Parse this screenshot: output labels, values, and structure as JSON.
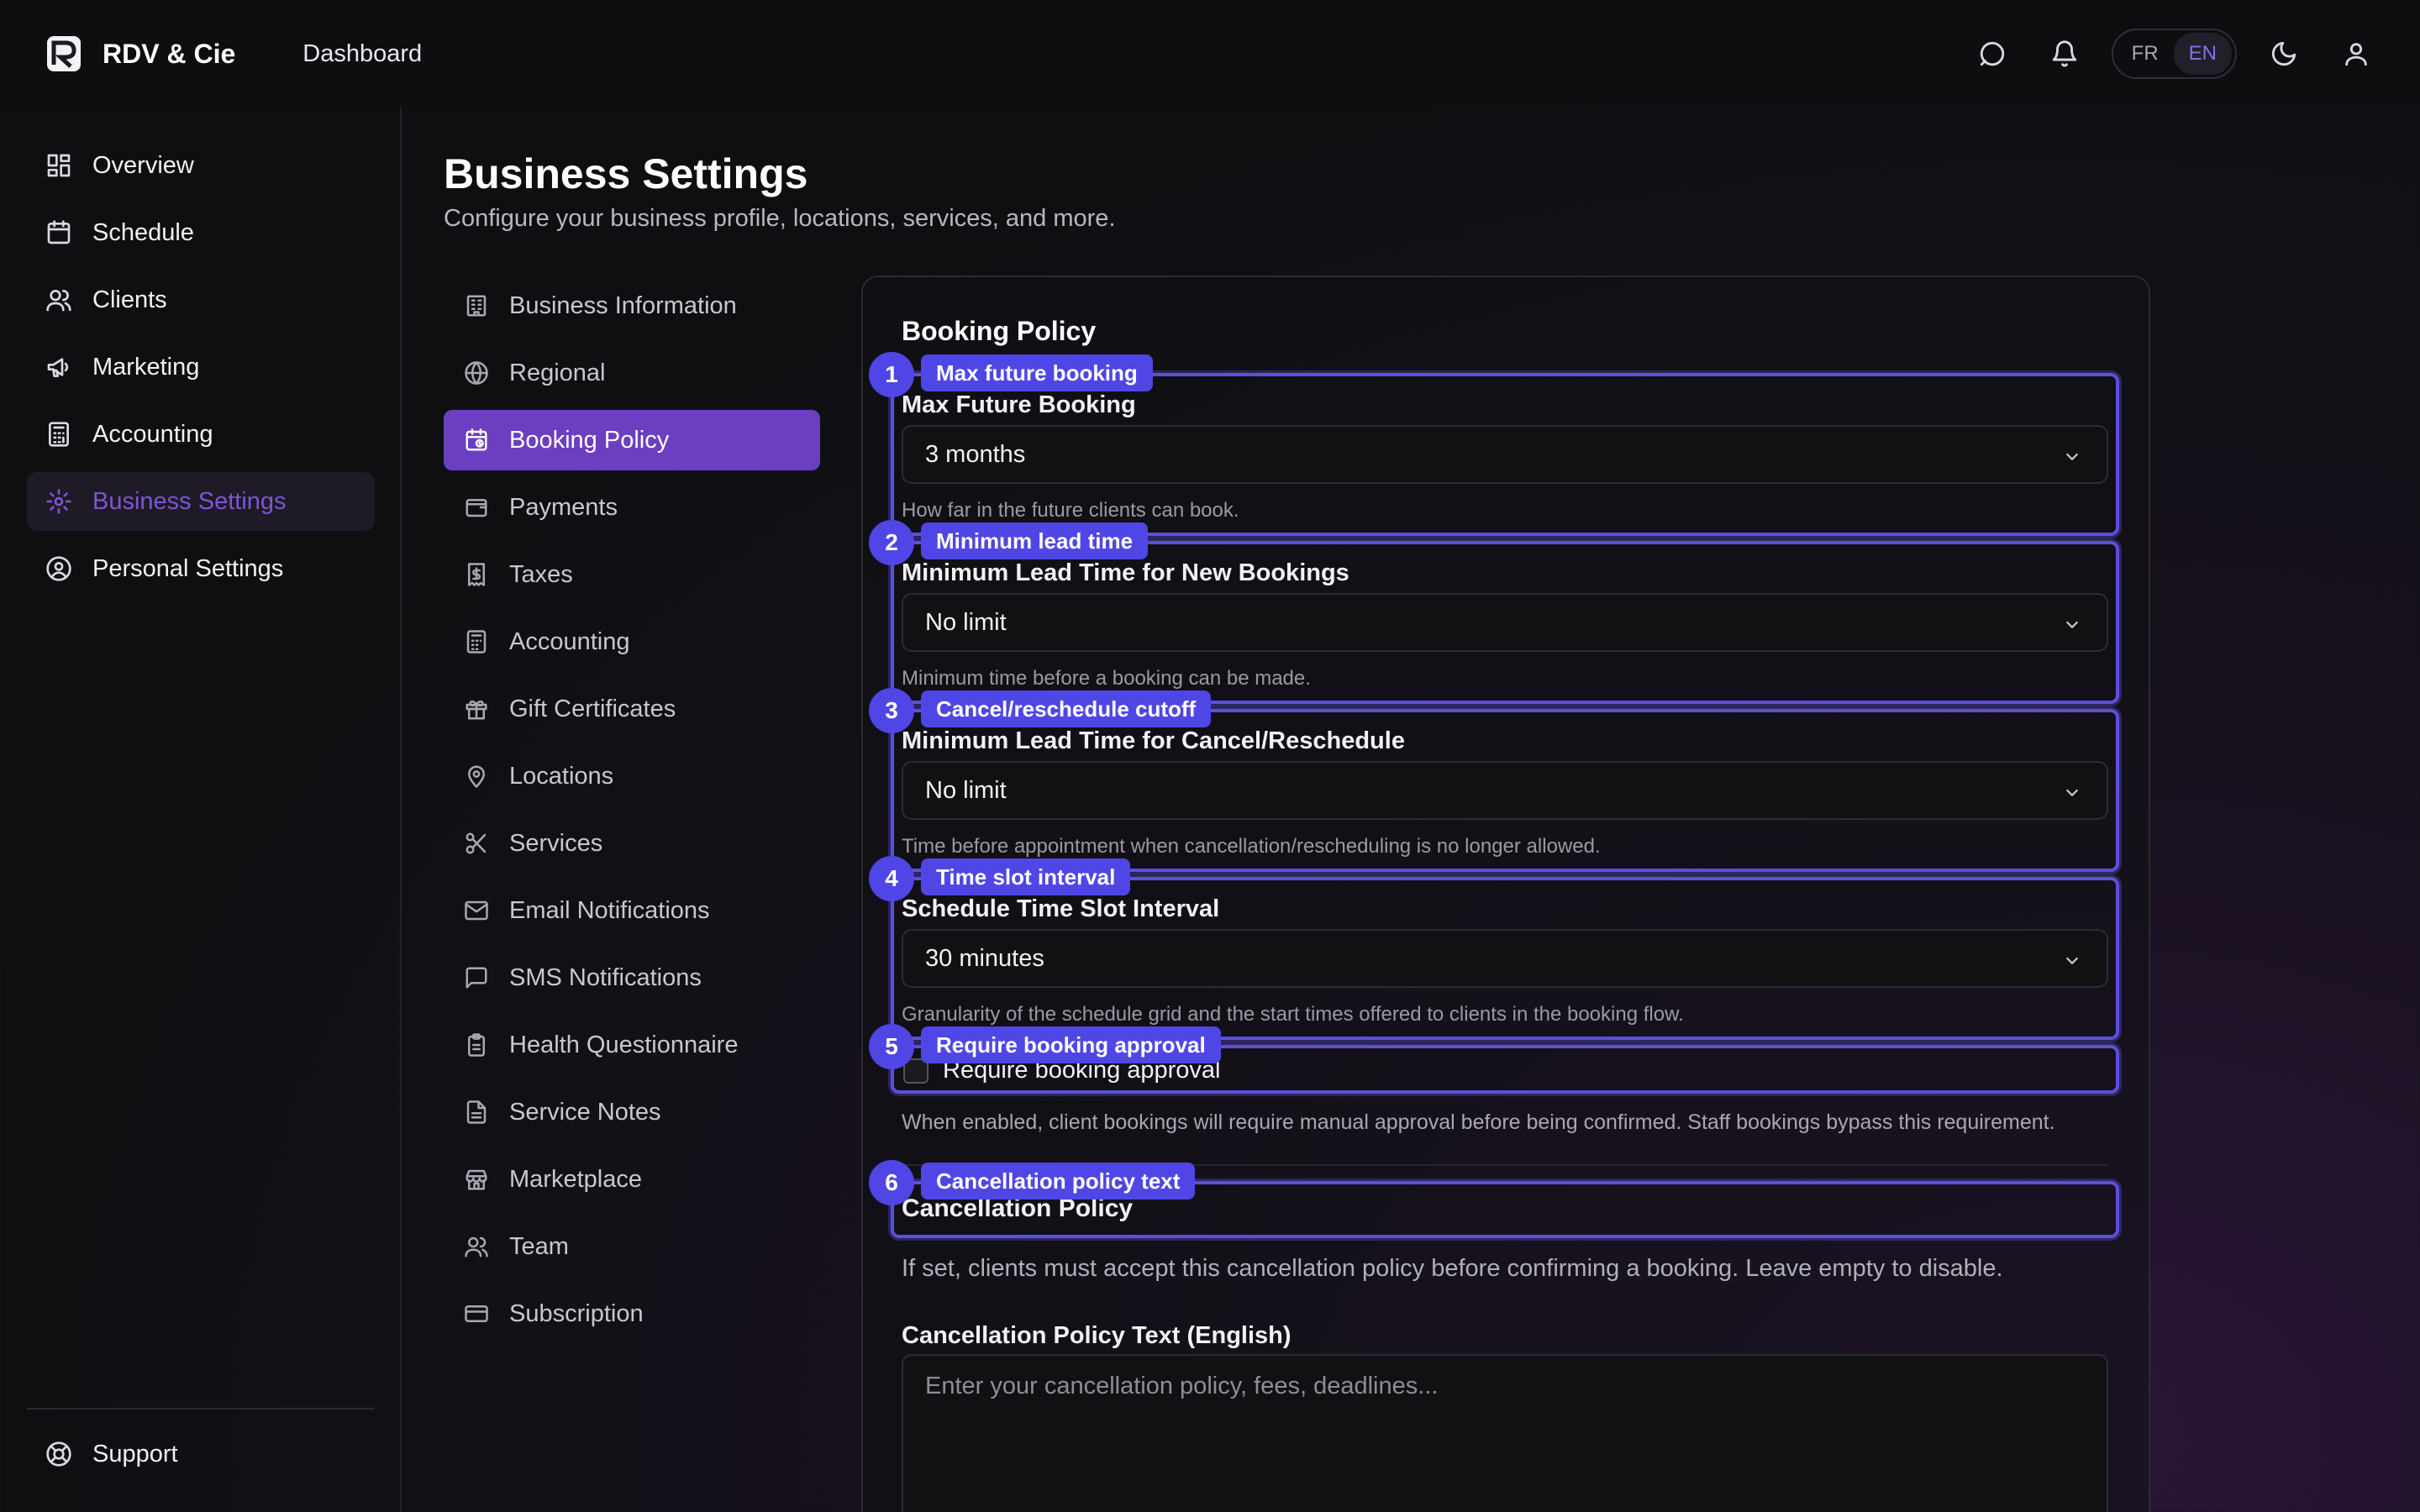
{
  "app": {
    "brand": "RDV & Cie",
    "top_nav": "Dashboard"
  },
  "header": {
    "lang_fr": "FR",
    "lang_en": "EN",
    "active_lang": "EN"
  },
  "sidebar": {
    "items": [
      {
        "label": "Overview",
        "icon": "grid-icon"
      },
      {
        "label": "Schedule",
        "icon": "calendar-icon"
      },
      {
        "label": "Clients",
        "icon": "users-icon"
      },
      {
        "label": "Marketing",
        "icon": "megaphone-icon"
      },
      {
        "label": "Accounting",
        "icon": "calculator-icon"
      },
      {
        "label": "Business Settings",
        "icon": "gear-icon",
        "active": true
      },
      {
        "label": "Personal Settings",
        "icon": "user-circle-icon"
      }
    ],
    "support": "Support"
  },
  "page": {
    "title": "Business Settings",
    "subtitle": "Configure your business profile, locations, services, and more."
  },
  "settings_nav": [
    "Business Information",
    "Regional",
    "Booking Policy",
    "Payments",
    "Taxes",
    "Accounting",
    "Gift Certificates",
    "Locations",
    "Services",
    "Email Notifications",
    "SMS Notifications",
    "Health Questionnaire",
    "Service Notes",
    "Marketplace",
    "Team",
    "Subscription"
  ],
  "settings_nav_active": "Booking Policy",
  "booking_policy": {
    "title": "Booking Policy",
    "max_future": {
      "label": "Max Future Booking",
      "value": "3 months",
      "hint": "How far in the future clients can book."
    },
    "min_lead": {
      "label": "Minimum Lead Time for New Bookings",
      "value": "No limit",
      "hint": "Minimum time before a booking can be made."
    },
    "cancel_lead": {
      "label": "Minimum Lead Time for Cancel/Reschedule",
      "value": "No limit",
      "hint": "Time before appointment when cancellation/rescheduling is no longer allowed."
    },
    "slot_interval": {
      "label": "Schedule Time Slot Interval",
      "value": "30 minutes",
      "hint": "Granularity of the schedule grid and the start times offered to clients in the booking flow."
    },
    "approval": {
      "label": "Require booking approval",
      "checked": false,
      "hint": "When enabled, client bookings will require manual approval before being confirmed. Staff bookings bypass this requirement."
    },
    "cancellation": {
      "heading": "Cancellation Policy",
      "hint": "If set, clients must accept this cancellation policy before confirming a booking. Leave empty to disable.",
      "text_label": "Cancellation Policy Text (English)",
      "placeholder": "Enter your cancellation policy, fees, deadlines..."
    }
  },
  "annotations": [
    {
      "num": "1",
      "label": "Max future booking"
    },
    {
      "num": "2",
      "label": "Minimum lead time"
    },
    {
      "num": "3",
      "label": "Cancel/reschedule cutoff"
    },
    {
      "num": "4",
      "label": "Time slot interval"
    },
    {
      "num": "5",
      "label": "Require booking approval"
    },
    {
      "num": "6",
      "label": "Cancellation policy text"
    }
  ],
  "colors": {
    "accent": "#6b3fc0",
    "annotation": "#4f46e5",
    "active_text": "#7c55d6"
  }
}
